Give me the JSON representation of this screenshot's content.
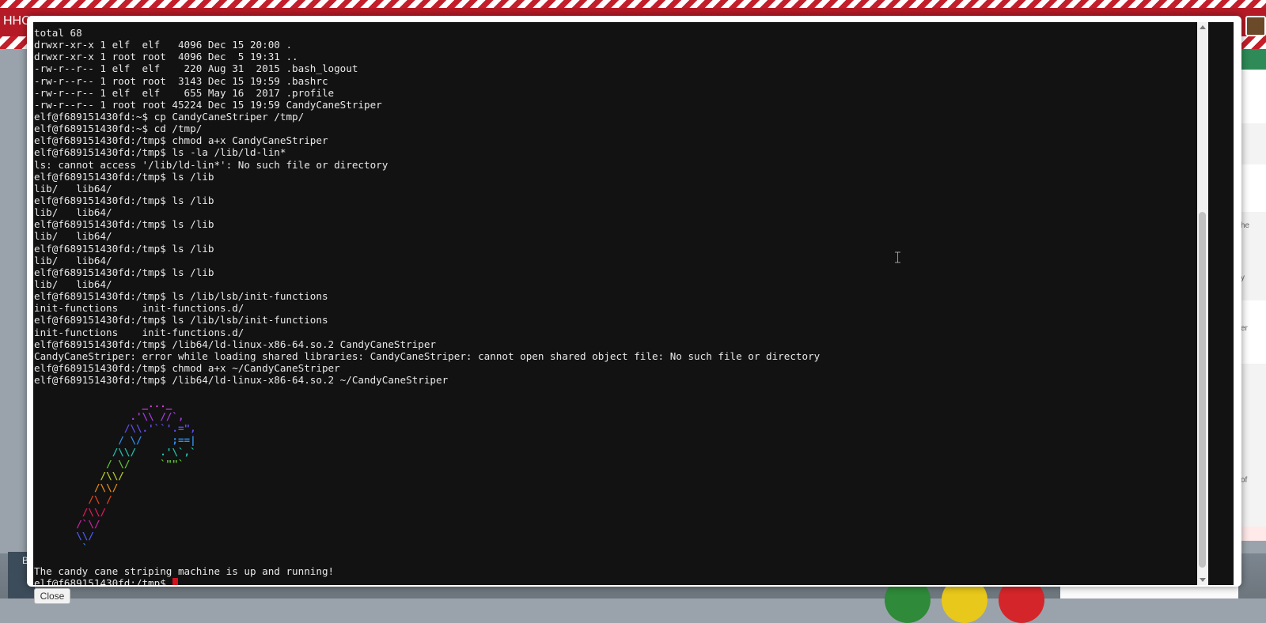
{
  "header": {
    "brand": "HHC"
  },
  "terminal": {
    "lines": [
      "total 68",
      "drwxr-xr-x 1 elf  elf   4096 Dec 15 20:00 .",
      "drwxr-xr-x 1 root root  4096 Dec  5 19:31 ..",
      "-rw-r--r-- 1 elf  elf    220 Aug 31  2015 .bash_logout",
      "-rw-r--r-- 1 root root  3143 Dec 15 19:59 .bashrc",
      "-rw-r--r-- 1 elf  elf    655 May 16  2017 .profile",
      "-rw-r--r-- 1 root root 45224 Dec 15 19:59 CandyCaneStriper",
      "elf@f689151430fd:~$ cp CandyCaneStriper /tmp/",
      "elf@f689151430fd:~$ cd /tmp/",
      "elf@f689151430fd:/tmp$ chmod a+x CandyCaneStriper",
      "elf@f689151430fd:/tmp$ ls -la /lib/ld-lin*",
      "ls: cannot access '/lib/ld-lin*': No such file or directory",
      "elf@f689151430fd:/tmp$ ls /lib",
      "lib/   lib64/",
      "elf@f689151430fd:/tmp$ ls /lib",
      "lib/   lib64/",
      "elf@f689151430fd:/tmp$ ls /lib",
      "lib/   lib64/",
      "elf@f689151430fd:/tmp$ ls /lib",
      "lib/   lib64/",
      "elf@f689151430fd:/tmp$ ls /lib",
      "lib/   lib64/",
      "elf@f689151430fd:/tmp$ ls /lib/lsb/init-functions",
      "init-functions    init-functions.d/",
      "elf@f689151430fd:/tmp$ ls /lib/lsb/init-functions",
      "init-functions    init-functions.d/",
      "elf@f689151430fd:/tmp$ /lib64/ld-linux-x86-64.so.2 CandyCaneStriper",
      "CandyCaneStriper: error while loading shared libraries: CandyCaneStriper: cannot open shared object file: No such file or directory",
      "elf@f689151430fd:/tmp$ chmod a+x ~/CandyCaneStriper",
      "elf@f689151430fd:/tmp$ /lib64/ld-linux-x86-64.so.2 ~/CandyCaneStriper"
    ],
    "art": [
      {
        "text": "                  _..._",
        "color": "#d23ad2"
      },
      {
        "text": "                .'\\\\ //`,",
        "color": "#a43be0"
      },
      {
        "text": "               /\\\\.'``'.=\",",
        "color": "#5f4cf0"
      },
      {
        "text": "              / \\/     ;==|",
        "color": "#2f8fef"
      },
      {
        "text": "             /\\\\/    .'\\`,`",
        "color": "#21c0a8"
      },
      {
        "text": "            / \\/     `\"\"`",
        "color": "#5fc03a"
      },
      {
        "text": "           /\\\\/",
        "color": "#b8c82a"
      },
      {
        "text": "          /\\\\/",
        "color": "#e08a1a"
      },
      {
        "text": "         /\\ /",
        "color": "#e0451a"
      },
      {
        "text": "        /\\\\/",
        "color": "#e0195a"
      },
      {
        "text": "       /`\\/",
        "color": "#c0249a"
      },
      {
        "text": "       \\\\/",
        "color": "#4a5af0"
      },
      {
        "text": "        `",
        "color": "#3a7ae0"
      }
    ],
    "message": "The candy cane striping machine is up and running!",
    "prompt": "elf@f689151430fd:/tmp$ "
  },
  "modal": {
    "close_label": "Close"
  },
  "side_panel": {
    "snippets": [
      "he",
      "y",
      "er",
      "of"
    ]
  },
  "colors": {
    "terminal_bg": "#121212",
    "terminal_fg": "#e8e8e8",
    "cursor": "#d4111e",
    "stripe_red": "#c41e2a"
  }
}
